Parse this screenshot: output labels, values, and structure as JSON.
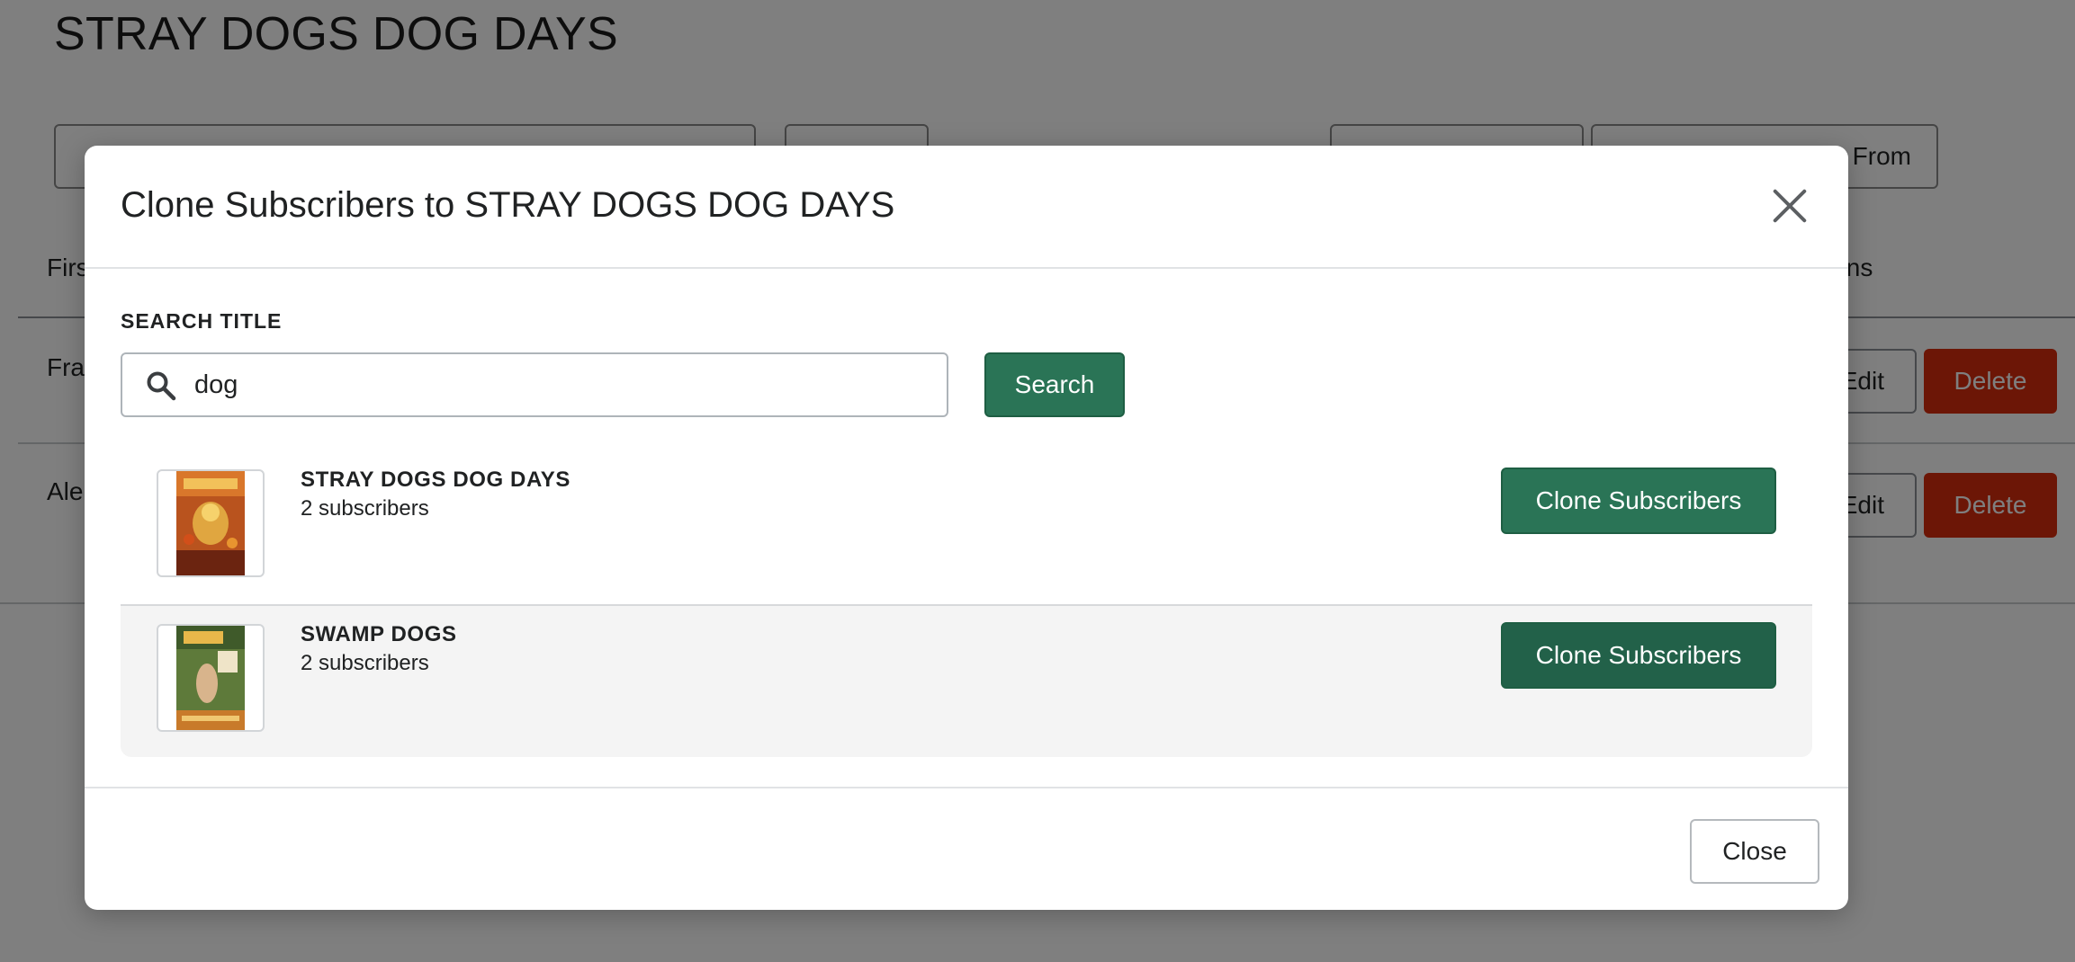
{
  "page": {
    "title": "STRAY DOGS DOG DAYS",
    "toolbar": {
      "from_button_label": "From"
    },
    "table": {
      "header_first": "Firs",
      "header_actions": "ions",
      "rows": [
        {
          "first_name": "Fra",
          "edit_label": "Edit",
          "delete_label": "Delete"
        },
        {
          "first_name": "Ale",
          "edit_label": "Edit",
          "delete_label": "Delete"
        }
      ]
    }
  },
  "modal": {
    "title": "Clone Subscribers to STRAY DOGS DOG DAYS",
    "close_icon": "close-icon",
    "search": {
      "label": "SEARCH TITLE",
      "value": "dog",
      "icon": "search-icon",
      "button_label": "Search"
    },
    "results": [
      {
        "title": "STRAY DOGS DOG DAYS",
        "subscribers": "2 subscribers",
        "button_label": "Clone Subscribers",
        "thumbnail": "stray-dogs-cover"
      },
      {
        "title": "SWAMP DOGS",
        "subscribers": "2 subscribers",
        "button_label": "Clone Subscribers",
        "thumbnail": "swamp-dogs-cover"
      }
    ],
    "footer": {
      "close_label": "Close"
    }
  },
  "colors": {
    "primary_green": "#2a7456",
    "danger_red": "#d82c0d",
    "backdrop": "rgba(0,0,0,0.5)"
  }
}
